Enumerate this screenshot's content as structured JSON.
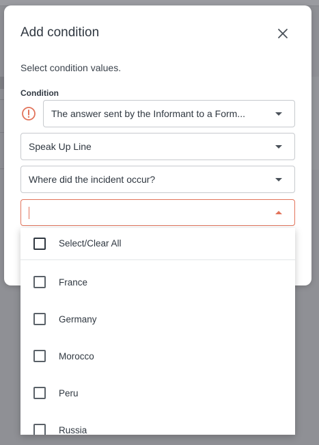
{
  "modal": {
    "title": "Add condition",
    "subtitle": "Select condition values.",
    "condition_label": "Condition",
    "selects": [
      {
        "value": "The answer sent by the Informant to a Form..."
      },
      {
        "value": "Speak Up Line"
      },
      {
        "value": "Where did the incident occur?"
      },
      {
        "value": ""
      }
    ]
  },
  "dropdown": {
    "select_all_label": "Select/Clear All",
    "options": [
      {
        "label": "France",
        "checked": false
      },
      {
        "label": "Germany",
        "checked": false
      },
      {
        "label": "Morocco",
        "checked": false
      },
      {
        "label": "Peru",
        "checked": false
      },
      {
        "label": "Russia",
        "checked": false
      }
    ]
  },
  "colors": {
    "accent_error": "#e2735a",
    "overlay": "#8f9095",
    "text": "#2f3740"
  },
  "icons": {
    "close": "close-icon",
    "error": "error-icon",
    "caret": "chevron-down-icon"
  }
}
